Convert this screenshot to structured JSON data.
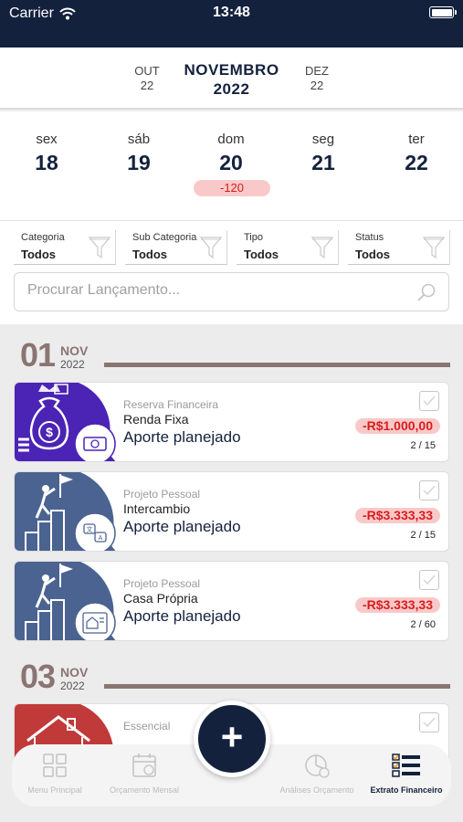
{
  "status_bar": {
    "carrier": "Carrier",
    "time": "13:48"
  },
  "month_nav": {
    "prev": {
      "month": "OUT",
      "year": "22"
    },
    "current": {
      "month": "NOVEMBRO",
      "year": "2022"
    },
    "next": {
      "month": "DEZ",
      "year": "22"
    }
  },
  "days": [
    {
      "name": "sex",
      "number": "18"
    },
    {
      "name": "sáb",
      "number": "19"
    },
    {
      "name": "dom",
      "number": "20",
      "badge": "-120"
    },
    {
      "name": "seg",
      "number": "21"
    },
    {
      "name": "ter",
      "number": "22"
    }
  ],
  "filters": [
    {
      "label": "Categoria",
      "value": "Todos"
    },
    {
      "label": "Sub Categoria",
      "value": "Todos"
    },
    {
      "label": "Tipo",
      "value": "Todos"
    },
    {
      "label": "Status",
      "value": "Todos"
    }
  ],
  "search": {
    "placeholder": "Procurar Lançamento..."
  },
  "groups": [
    {
      "day": "01",
      "month": "NOV",
      "year": "2022",
      "entries": [
        {
          "category": "Reserva Financeira",
          "subcategory": "Renda Fixa",
          "title": "Aporte planejado",
          "amount": "-R$1.000,00",
          "count": "2 / 15",
          "thumb_icon": "money-bag-icon",
          "badge_icon": "cash-icon"
        },
        {
          "category": "Projeto Pessoal",
          "subcategory": "Intercambio",
          "title": "Aporte planejado",
          "amount": "-R$3.333,33",
          "count": "2 / 15",
          "thumb_icon": "climber-flag-icon",
          "badge_icon": "language-icon"
        },
        {
          "category": "Projeto Pessoal",
          "subcategory": "Casa Própria",
          "title": "Aporte planejado",
          "amount": "-R$3.333,33",
          "count": "2 / 60",
          "thumb_icon": "climber-flag-icon",
          "badge_icon": "house-sale-icon"
        }
      ]
    },
    {
      "day": "03",
      "month": "NOV",
      "year": "2022",
      "entries": [
        {
          "category": "Essencial",
          "thumb_icon": "house-icon"
        }
      ]
    }
  ],
  "tab_bar": [
    {
      "label": "Menu Principal",
      "icon": "grid-icon",
      "active": false
    },
    {
      "label": "Orçamento Mensal",
      "icon": "calendar-icon",
      "active": false
    },
    {
      "label": "Análises Orçamento",
      "icon": "pie-chart-icon",
      "active": false
    },
    {
      "label": "Extrato Financeiro",
      "icon": "statement-icon",
      "active": true
    }
  ],
  "fab": {
    "label": "+"
  },
  "colors": {
    "navy": "#14213d",
    "negative": "#d91d1d",
    "negative_bg": "#f9c9c9",
    "date_accent": "#8a7572",
    "purple": "#4b23b5",
    "slate_blue": "#4b6390",
    "red_thumb": "#c03a3a"
  }
}
